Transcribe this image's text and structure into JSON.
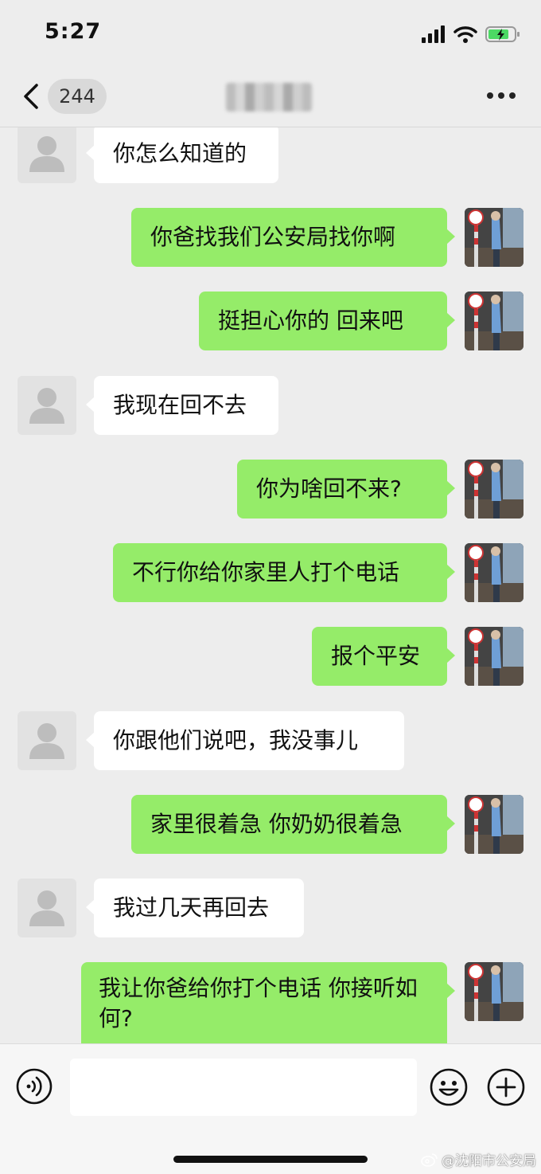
{
  "status": {
    "time": "5:27"
  },
  "nav": {
    "unread_count": "244",
    "title": ""
  },
  "messages": [
    {
      "side": "in",
      "text": "你怎么知道的"
    },
    {
      "side": "out",
      "text": "你爸找我们公安局找你啊"
    },
    {
      "side": "out",
      "text": "挺担心你的  回来吧"
    },
    {
      "side": "in",
      "text": "我现在回不去"
    },
    {
      "side": "out",
      "text": "你为啥回不来?"
    },
    {
      "side": "out",
      "text": "不行你给你家里人打个电话"
    },
    {
      "side": "out",
      "text": "报个平安"
    },
    {
      "side": "in",
      "text": "你跟他们说吧，我没事儿"
    },
    {
      "side": "out",
      "text": "家里很着急 你奶奶很着急"
    },
    {
      "side": "in",
      "text": "我过几天再回去"
    },
    {
      "side": "out",
      "text": "我让你爸给你打个电话 你接听如何?"
    }
  ],
  "input": {
    "placeholder": ""
  },
  "watermark": "@沈阳市公安局",
  "colors": {
    "outgoing_bubble": "#95ec69",
    "incoming_bubble": "#ffffff",
    "background": "#ededed"
  },
  "icons": [
    "back-icon",
    "more-icon",
    "voice-icon",
    "emoji-icon",
    "plus-icon",
    "signal-icon",
    "wifi-icon",
    "battery-icon",
    "weibo-icon"
  ]
}
